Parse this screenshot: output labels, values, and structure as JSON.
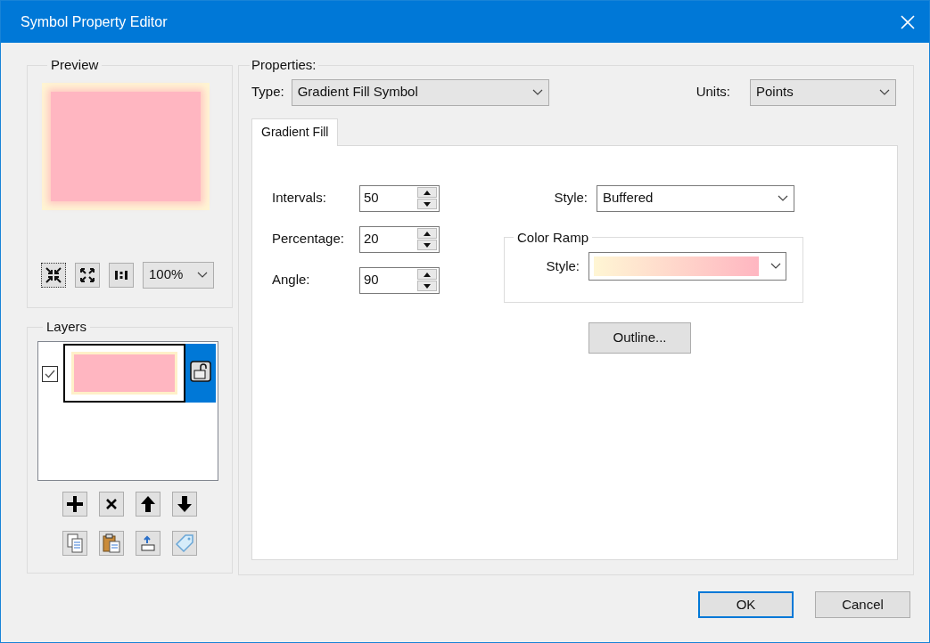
{
  "window": {
    "title": "Symbol Property Editor"
  },
  "preview": {
    "label": "Preview",
    "zoom": "100%"
  },
  "layers": {
    "label": "Layers",
    "items": [
      {
        "checked": true,
        "selected": true
      }
    ]
  },
  "properties": {
    "label": "Properties:",
    "type_label": "Type:",
    "type": "Gradient Fill Symbol",
    "units_label": "Units:",
    "units": "Points",
    "tabs": [
      {
        "label": "Gradient Fill",
        "selected": true
      }
    ],
    "fields": [
      {
        "label": "Intervals:",
        "value": "50"
      },
      {
        "label": "Percentage:",
        "value": "20"
      },
      {
        "label": "Angle:",
        "value": "90"
      }
    ],
    "style_label": "Style:",
    "style": "Buffered",
    "color_ramp": {
      "label": "Color Ramp",
      "style_label": "Style:"
    },
    "outline_button": "Outline..."
  },
  "buttons": [
    {
      "label": "OK",
      "default": true
    },
    {
      "label": "Cancel",
      "default": false
    }
  ]
}
